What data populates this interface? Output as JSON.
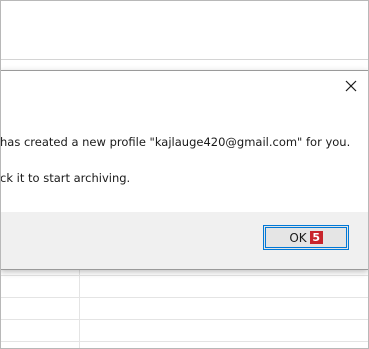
{
  "dialog": {
    "message_line1": "has created a new profile \"kajlauge420@gmail.com\" for you.",
    "message_line2": "ck it to start archiving.",
    "close_icon": "close-icon",
    "ok_button": {
      "label": "OK",
      "countdown": "5"
    }
  },
  "colors": {
    "accent": "#0078d7",
    "countdown_badge": "#c8252c",
    "footer_background": "#f0f0f0"
  }
}
